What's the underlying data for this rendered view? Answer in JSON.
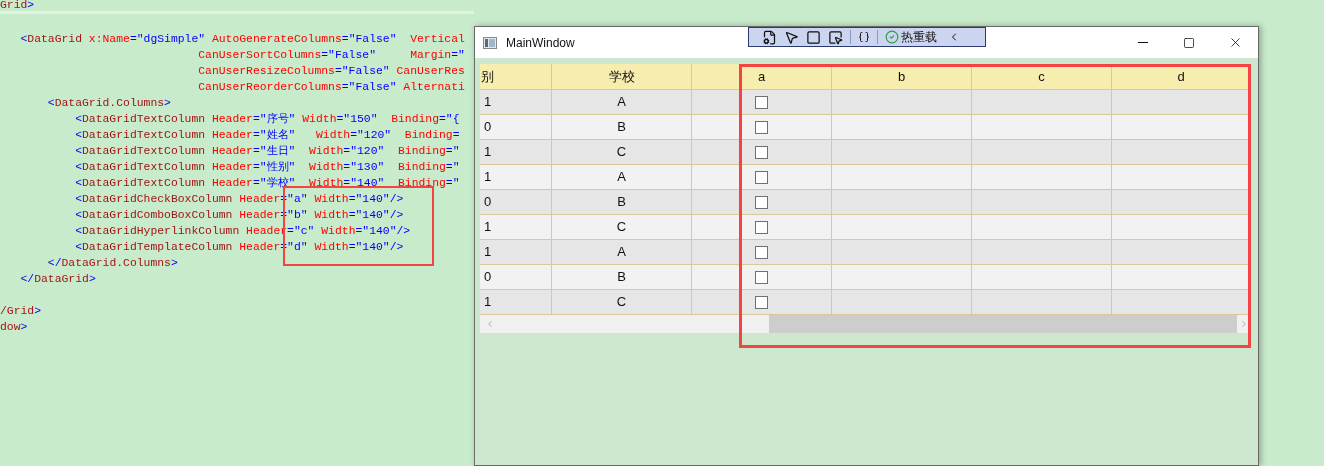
{
  "editor": {
    "lines": [
      [
        {
          "kind": "element",
          "text": "Grid"
        },
        {
          "kind": "punct",
          "text": ">"
        }
      ],
      [
        {
          "kind": "punct",
          "text": "   <"
        },
        {
          "kind": "element",
          "text": "DataGrid"
        },
        {
          "kind": "attr",
          "text": " x:Name"
        },
        {
          "kind": "value",
          "text": "=\"dgSimple\""
        },
        {
          "kind": "attr",
          "text": " AutoGenerateColumns"
        },
        {
          "kind": "value",
          "text": "=\"False\""
        },
        {
          "kind": "attr",
          "text": "  Vertical"
        }
      ],
      [
        {
          "kind": "attr",
          "text": "                             CanUserSortColumns"
        },
        {
          "kind": "value",
          "text": "=\"False\""
        },
        {
          "kind": "attr",
          "text": "     Margin"
        },
        {
          "kind": "value",
          "text": "=\""
        }
      ],
      [
        {
          "kind": "attr",
          "text": "                             CanUserResizeColumns"
        },
        {
          "kind": "value",
          "text": "=\"False\""
        },
        {
          "kind": "attr",
          "text": " CanUserRes"
        }
      ],
      [
        {
          "kind": "attr",
          "text": "                             CanUserReorderColumns"
        },
        {
          "kind": "value",
          "text": "=\"False\""
        },
        {
          "kind": "attr",
          "text": " Alternati"
        }
      ],
      [
        {
          "kind": "punct",
          "text": "       <"
        },
        {
          "kind": "element",
          "text": "DataGrid.Columns"
        },
        {
          "kind": "punct",
          "text": ">"
        }
      ],
      [
        {
          "kind": "punct",
          "text": "           <"
        },
        {
          "kind": "element",
          "text": "DataGridTextColumn"
        },
        {
          "kind": "attr",
          "text": " Header"
        },
        {
          "kind": "value",
          "text": "=\"序号\""
        },
        {
          "kind": "attr",
          "text": " Width"
        },
        {
          "kind": "value",
          "text": "=\"150\""
        },
        {
          "kind": "attr",
          "text": "  Binding"
        },
        {
          "kind": "value",
          "text": "=\"{"
        }
      ],
      [
        {
          "kind": "punct",
          "text": "           <"
        },
        {
          "kind": "element",
          "text": "DataGridTextColumn"
        },
        {
          "kind": "attr",
          "text": " Header"
        },
        {
          "kind": "value",
          "text": "=\"姓名\""
        },
        {
          "kind": "attr",
          "text": "   Width"
        },
        {
          "kind": "value",
          "text": "=\"120\""
        },
        {
          "kind": "attr",
          "text": "  Binding"
        },
        {
          "kind": "value",
          "text": "="
        }
      ],
      [
        {
          "kind": "punct",
          "text": "           <"
        },
        {
          "kind": "element",
          "text": "DataGridTextColumn"
        },
        {
          "kind": "attr",
          "text": " Header"
        },
        {
          "kind": "value",
          "text": "=\"生日\""
        },
        {
          "kind": "attr",
          "text": "  Width"
        },
        {
          "kind": "value",
          "text": "=\"120\""
        },
        {
          "kind": "attr",
          "text": "  Binding"
        },
        {
          "kind": "value",
          "text": "=\""
        }
      ],
      [
        {
          "kind": "punct",
          "text": "           <"
        },
        {
          "kind": "element",
          "text": "DataGridTextColumn"
        },
        {
          "kind": "attr",
          "text": " Header"
        },
        {
          "kind": "value",
          "text": "=\"性别\""
        },
        {
          "kind": "attr",
          "text": "  Width"
        },
        {
          "kind": "value",
          "text": "=\"130\""
        },
        {
          "kind": "attr",
          "text": "  Binding"
        },
        {
          "kind": "value",
          "text": "=\""
        }
      ],
      [
        {
          "kind": "punct",
          "text": "           <"
        },
        {
          "kind": "element",
          "text": "DataGridTextColumn"
        },
        {
          "kind": "attr",
          "text": " Header"
        },
        {
          "kind": "value",
          "text": "=\"学校\""
        },
        {
          "kind": "attr",
          "text": "  Width"
        },
        {
          "kind": "value",
          "text": "=\"140\""
        },
        {
          "kind": "attr",
          "text": "  Binding"
        },
        {
          "kind": "value",
          "text": "=\""
        }
      ],
      [
        {
          "kind": "punct",
          "text": "           <"
        },
        {
          "kind": "element",
          "text": "DataGridCheckBoxColumn"
        },
        {
          "kind": "attr",
          "text": " Header"
        },
        {
          "kind": "value",
          "text": "=\"a\""
        },
        {
          "kind": "attr",
          "text": " Width"
        },
        {
          "kind": "value",
          "text": "=\"140\"/>"
        }
      ],
      [
        {
          "kind": "punct",
          "text": "           <"
        },
        {
          "kind": "element",
          "text": "DataGridComboBoxColumn"
        },
        {
          "kind": "attr",
          "text": " Header"
        },
        {
          "kind": "value",
          "text": "=\"b\""
        },
        {
          "kind": "attr",
          "text": " Width"
        },
        {
          "kind": "value",
          "text": "=\"140\"/>"
        }
      ],
      [
        {
          "kind": "punct",
          "text": "           <"
        },
        {
          "kind": "element",
          "text": "DataGridHyperlinkColumn"
        },
        {
          "kind": "attr",
          "text": " Header"
        },
        {
          "kind": "value",
          "text": "=\"c\""
        },
        {
          "kind": "attr",
          "text": " Width"
        },
        {
          "kind": "value",
          "text": "=\"140\"/>"
        }
      ],
      [
        {
          "kind": "punct",
          "text": "           <"
        },
        {
          "kind": "element",
          "text": "DataGridTemplateColumn"
        },
        {
          "kind": "attr",
          "text": " Header"
        },
        {
          "kind": "value",
          "text": "=\"d\""
        },
        {
          "kind": "attr",
          "text": " Width"
        },
        {
          "kind": "value",
          "text": "=\"140\"/>"
        }
      ],
      [
        {
          "kind": "punct",
          "text": "       </"
        },
        {
          "kind": "element",
          "text": "DataGrid.Columns"
        },
        {
          "kind": "punct",
          "text": ">"
        }
      ],
      [
        {
          "kind": "punct",
          "text": "   </"
        },
        {
          "kind": "element",
          "text": "DataGrid"
        },
        {
          "kind": "punct",
          "text": ">"
        }
      ],
      {
        "blank_before": true,
        "tokens": [
          {
            "kind": "element",
            "text": "/Grid"
          },
          {
            "kind": "punct",
            "text": ">"
          }
        ]
      },
      [
        {
          "kind": "element",
          "text": "dow"
        },
        {
          "kind": "punct",
          "text": ">"
        }
      ]
    ]
  },
  "window": {
    "title": "MainWindow",
    "debug_toolbar": {
      "hot_reload": "热重载"
    },
    "grid": {
      "columns": [
        "别",
        "学校",
        "a",
        "b",
        "c",
        "d"
      ],
      "rows": [
        {
          "cells": [
            "1",
            "A"
          ],
          "checked": false
        },
        {
          "cells": [
            "0",
            "B"
          ],
          "checked": false
        },
        {
          "cells": [
            "1",
            "C"
          ],
          "checked": false
        },
        {
          "cells": [
            "1",
            "A"
          ],
          "checked": false
        },
        {
          "cells": [
            "0",
            "B"
          ],
          "checked": false
        },
        {
          "cells": [
            "1",
            "C"
          ],
          "checked": false
        },
        {
          "cells": [
            "1",
            "A"
          ],
          "checked": false
        },
        {
          "cells": [
            "0",
            "B"
          ],
          "checked": false
        },
        {
          "cells": [
            "1",
            "C"
          ],
          "checked": false
        }
      ]
    }
  }
}
